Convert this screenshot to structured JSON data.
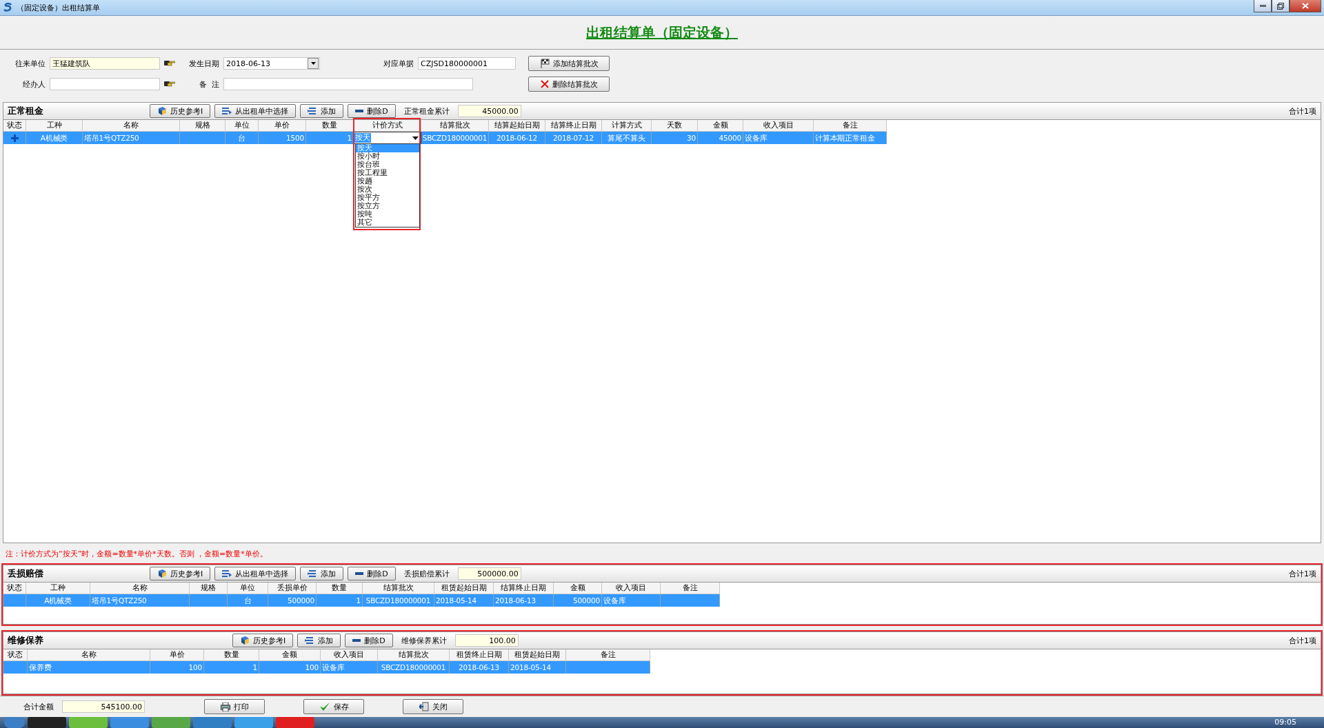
{
  "window": {
    "title": "（固定设备）出租结算单"
  },
  "form_title": "出租结算单（固定设备）",
  "form": {
    "partner": {
      "label": "往来单位",
      "value": "王猛建筑队"
    },
    "date": {
      "label": "发生日期",
      "value": "2018-06-13"
    },
    "document": {
      "label": "对应单据",
      "value": "CZJSD180000001"
    },
    "handler": {
      "label": "经办人"
    },
    "remark": {
      "label": "备  注"
    },
    "buttons": [
      {
        "kind": "add",
        "label": "添加结算批次"
      },
      {
        "kind": "delete",
        "label": "删除结算批次"
      }
    ]
  },
  "sections": [
    {
      "title": "正常租金",
      "highlighted": false,
      "buttons": [
        {
          "kind": "history",
          "label": "历史参考I"
        },
        {
          "kind": "select",
          "label": "从出租单中选择"
        },
        {
          "kind": "add",
          "label": "添加"
        },
        {
          "kind": "delete",
          "label": "删除D"
        }
      ],
      "total_label": "正常租金累计",
      "total": "45000.00",
      "count": "合计1项",
      "columns": [
        "状态",
        "工种",
        "名称",
        "规格",
        "单位",
        "单价",
        "数量",
        "计价方式",
        "结算批次",
        "结算起始日期",
        "结算终止日期",
        "计算方式",
        "天数",
        "金额",
        "收入项目",
        "备注"
      ],
      "rows": [
        {
          "selected": true,
          "new": true,
          "cells": [
            "",
            "A机械类",
            "塔吊1号QTZ250",
            "",
            "台",
            "1500",
            "1",
            "按天",
            "SBCZD180000001",
            "2018-06-12",
            "2018-07-12",
            "算尾不算头",
            "30",
            "45000",
            "设备库",
            "计算本期正常租金"
          ]
        }
      ],
      "dropdown": {
        "highlighted": true,
        "options": [
          {
            "label": "按天",
            "selected": true
          },
          {
            "label": "按小时",
            "selected": false
          },
          {
            "label": "按台班",
            "selected": false
          },
          {
            "label": "按工程里",
            "selected": false
          },
          {
            "label": "按趟",
            "selected": false
          },
          {
            "label": "按次",
            "selected": false
          },
          {
            "label": "按平方",
            "selected": false
          },
          {
            "label": "按立方",
            "selected": false
          },
          {
            "label": "按吨",
            "selected": false
          },
          {
            "label": "其它",
            "selected": false
          }
        ]
      },
      "note": "注：计价方式为“按天”时，金额=数量*单价*天数。否则 ，金额=数量*单价。"
    },
    {
      "title": "丢损赔偿",
      "highlighted": true,
      "buttons": [
        {
          "kind": "history",
          "label": "历史参考I"
        },
        {
          "kind": "select",
          "label": "从出租单中选择"
        },
        {
          "kind": "add",
          "label": "添加"
        },
        {
          "kind": "delete",
          "label": "删除D"
        }
      ],
      "total_label": "丢损赔偿累计",
      "total": "500000.00",
      "count": "合计1项",
      "columns": [
        "状态",
        "工种",
        "名称",
        "规格",
        "单位",
        "丢损单价",
        "数量",
        "结算批次",
        "租赁起始日期",
        "结算终止日期",
        "金额",
        "收入项目",
        "备注"
      ],
      "rows": [
        {
          "selected": true,
          "new": false,
          "cells": [
            "",
            "A机械类",
            "塔吊1号QTZ250",
            "",
            "台",
            "500000",
            "1",
            "SBCZD180000001",
            "2018-05-14",
            "2018-06-13",
            "500000",
            "设备库",
            ""
          ]
        }
      ]
    },
    {
      "title": "维修保养",
      "highlighted": true,
      "buttons": [
        {
          "kind": "history",
          "label": "历史参考I"
        },
        {
          "kind": "add",
          "label": "添加"
        },
        {
          "kind": "delete",
          "label": "删除D"
        }
      ],
      "total_label": "维修保养累计",
      "total": "100.00",
      "count": "合计1项",
      "columns": [
        "状态",
        "名称",
        "单价",
        "数量",
        "金额",
        "收入项目",
        "结算批次",
        "租赁终止日期",
        "租赁起始日期",
        "备注"
      ],
      "rows": [
        {
          "selected": true,
          "new": false,
          "cells": [
            "",
            "保养费",
            "100",
            "1",
            "100",
            "设备库",
            "SBCZD180000001",
            "2018-06-13",
            "2018-05-14",
            ""
          ]
        }
      ]
    }
  ],
  "footer": {
    "total_label": "合计金额",
    "total": "545100.00",
    "buttons": [
      {
        "kind": "print",
        "label": "打印"
      },
      {
        "kind": "save",
        "label": "保存"
      },
      {
        "kind": "close",
        "label": "关闭"
      }
    ]
  },
  "taskbar": {
    "clock": "09:05"
  }
}
